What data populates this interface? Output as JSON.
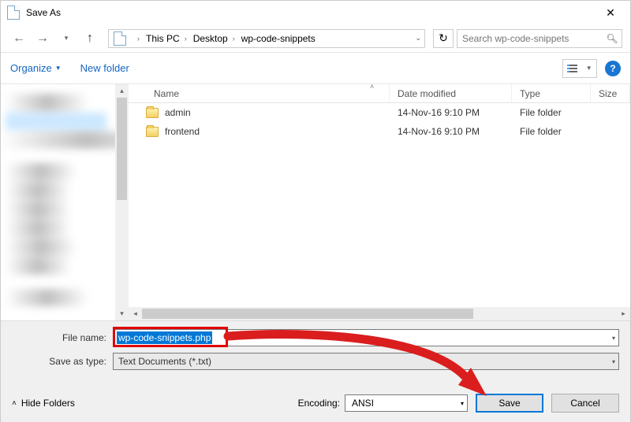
{
  "window": {
    "title": "Save As",
    "close_tooltip": "Close"
  },
  "nav": {
    "breadcrumb": [
      "This PC",
      "Desktop",
      "wp-code-snippets"
    ],
    "search_placeholder": "Search wp-code-snippets"
  },
  "toolbar": {
    "organize": "Organize",
    "new_folder": "New folder"
  },
  "columns": {
    "name": "Name",
    "date": "Date modified",
    "type": "Type",
    "size": "Size"
  },
  "rows": [
    {
      "name": "admin",
      "date": "14-Nov-16 9:10 PM",
      "type": "File folder"
    },
    {
      "name": "frontend",
      "date": "14-Nov-16 9:10 PM",
      "type": "File folder"
    }
  ],
  "form": {
    "filename_label": "File name:",
    "filename_value": "wp-code-snippets.php",
    "savetype_label": "Save as type:",
    "savetype_value": "Text Documents (*.txt)",
    "encoding_label": "Encoding:",
    "encoding_value": "ANSI",
    "hide_folders": "Hide Folders",
    "save": "Save",
    "cancel": "Cancel"
  }
}
